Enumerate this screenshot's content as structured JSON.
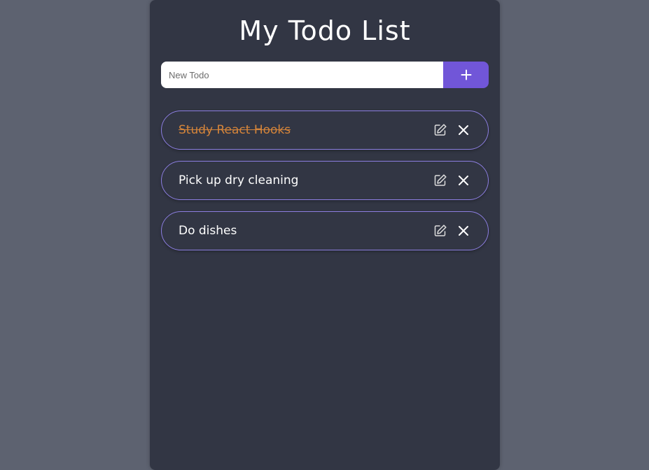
{
  "app": {
    "title": "My Todo List"
  },
  "new_todo": {
    "placeholder": "New Todo",
    "value": "",
    "add_icon": "plus-icon"
  },
  "todos": [
    {
      "text": "Study React Hooks",
      "completed": true
    },
    {
      "text": "Pick up dry cleaning",
      "completed": false
    },
    {
      "text": "Do dishes",
      "completed": false
    }
  ],
  "icons": {
    "edit": "edit-icon",
    "delete": "close-icon"
  },
  "colors": {
    "background": "#5d6270",
    "panel": "#323644",
    "accent": "#7156d8",
    "item_border": "#8c7ee0",
    "completed_text": "#d4843a"
  }
}
